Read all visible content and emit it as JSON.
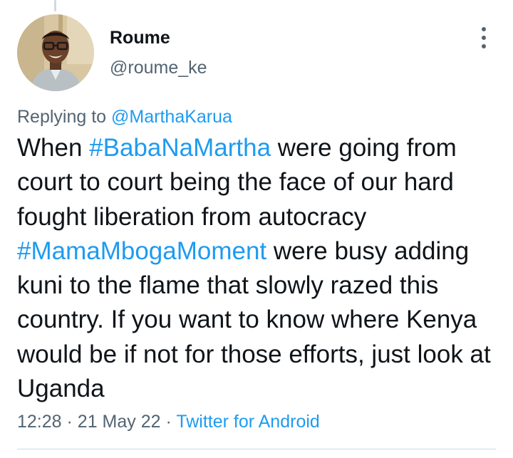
{
  "tweet": {
    "author": {
      "display_name": "Roume",
      "handle": "@roume_ke"
    },
    "replying_to": {
      "prefix": "Replying to",
      "mention": "@MarthaKarua"
    },
    "text_segments": [
      {
        "type": "text",
        "value": "When "
      },
      {
        "type": "hashtag",
        "value": "#BabaNaMartha"
      },
      {
        "type": "text",
        "value": " were going from court to court being the face of our hard fought liberation from autocracy "
      },
      {
        "type": "hashtag",
        "value": "#MamaMbogaMoment"
      },
      {
        "type": "text",
        "value": " were busy adding kuni to the flame that slowly razed this country. If you want to know where Kenya would be if not for those efforts, just look at Uganda"
      }
    ],
    "time": "12:28",
    "separator": "·",
    "date": "21 May 22",
    "source": "Twitter for Android"
  },
  "colors": {
    "link": "#1d9bf0",
    "secondary_text": "#536471",
    "primary_text": "#0f1419"
  },
  "icons": {
    "more": "more-vertical-icon"
  }
}
